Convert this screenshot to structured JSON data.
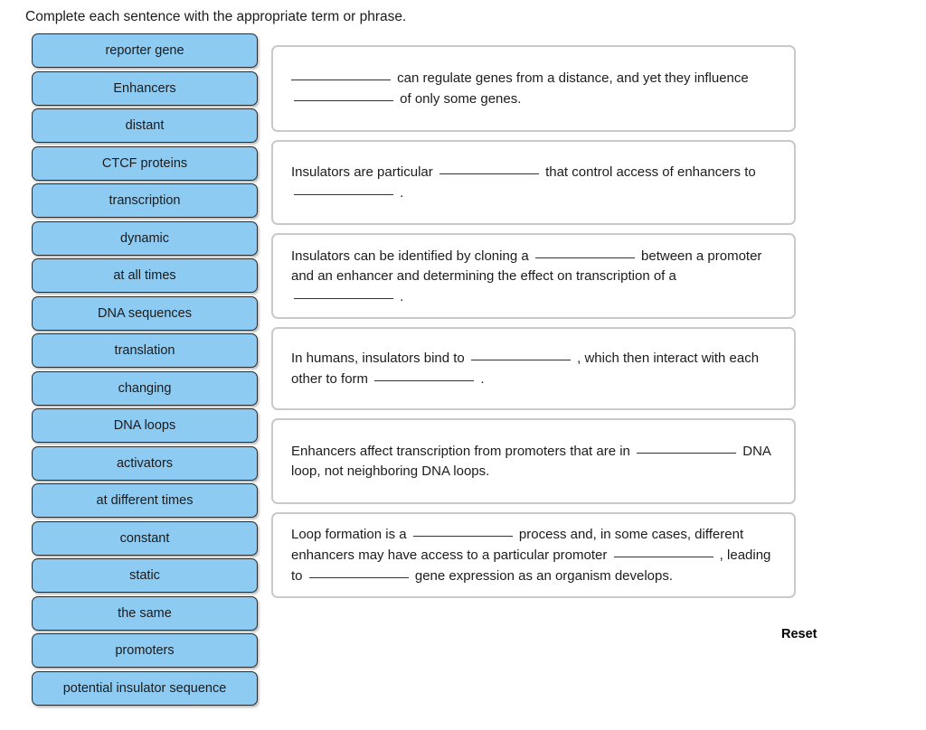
{
  "prompt": "Complete each sentence with the appropriate term or phrase.",
  "reset_label": "Reset",
  "tiles": [
    {
      "label": "reporter gene"
    },
    {
      "label": "Enhancers"
    },
    {
      "label": "distant"
    },
    {
      "label": "CTCF proteins"
    },
    {
      "label": "transcription"
    },
    {
      "label": "dynamic"
    },
    {
      "label": "at all times"
    },
    {
      "label": "DNA sequences"
    },
    {
      "label": "translation"
    },
    {
      "label": "changing"
    },
    {
      "label": "DNA loops"
    },
    {
      "label": "activators"
    },
    {
      "label": "at different times"
    },
    {
      "label": "constant"
    },
    {
      "label": "static"
    },
    {
      "label": "the same"
    },
    {
      "label": "promoters"
    },
    {
      "label": "potential insulator sequence"
    }
  ],
  "sentences": [
    {
      "id": "box-1",
      "parts": [
        {
          "type": "blank"
        },
        {
          "type": "text",
          "value": " can regulate genes from a distance, and yet they influence "
        },
        {
          "type": "blank"
        },
        {
          "type": "text",
          "value": " of only some genes."
        }
      ]
    },
    {
      "id": "box-2",
      "parts": [
        {
          "type": "text",
          "value": "Insulators are particular "
        },
        {
          "type": "blank"
        },
        {
          "type": "text",
          "value": " that control access of enhancers to "
        },
        {
          "type": "blank"
        },
        {
          "type": "text",
          "value": " ."
        }
      ]
    },
    {
      "id": "box-3",
      "parts": [
        {
          "type": "text",
          "value": "Insulators can be identified by cloning a "
        },
        {
          "type": "blank"
        },
        {
          "type": "text",
          "value": " between a promoter and an enhancer and determining the effect on transcription of a "
        },
        {
          "type": "blank"
        },
        {
          "type": "text",
          "value": " ."
        }
      ]
    },
    {
      "id": "box-4",
      "parts": [
        {
          "type": "text",
          "value": "In humans, insulators bind to "
        },
        {
          "type": "blank"
        },
        {
          "type": "text",
          "value": " , which then interact with each other to form "
        },
        {
          "type": "blank"
        },
        {
          "type": "text",
          "value": " ."
        }
      ]
    },
    {
      "id": "box-5",
      "parts": [
        {
          "type": "text",
          "value": "Enhancers affect transcription from promoters that are in "
        },
        {
          "type": "blank"
        },
        {
          "type": "text",
          "value": " DNA loop, not neighboring DNA loops."
        }
      ]
    },
    {
      "id": "box-6",
      "parts": [
        {
          "type": "text",
          "value": "Loop formation is a "
        },
        {
          "type": "blank"
        },
        {
          "type": "text",
          "value": " process and, in some cases, different enhancers may have access to a particular promoter "
        },
        {
          "type": "blank"
        },
        {
          "type": "text",
          "value": " , leading to "
        },
        {
          "type": "blank"
        },
        {
          "type": "text",
          "value": " gene expression as an organism develops."
        }
      ]
    }
  ],
  "colors": {
    "tile_fill": "#8ecbf2",
    "tile_border": "#2b2b2b",
    "box_border": "#c9c9c9",
    "text": "#1c1c1c"
  }
}
